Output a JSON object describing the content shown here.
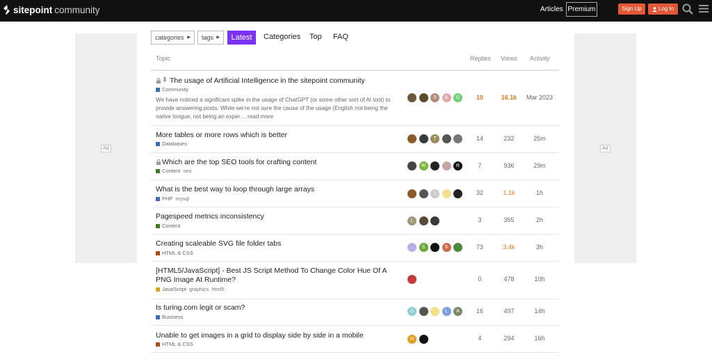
{
  "header": {
    "brand": "sitepoint",
    "brand_sub": "community",
    "nav_articles": "Articles",
    "nav_premium": "Premium",
    "signup": "Sign Up",
    "login": "Log In"
  },
  "ad_label": "Ad",
  "nav": {
    "categories_dropdown": "categories",
    "tags_dropdown": "tags",
    "latest": "Latest",
    "categories": "Categories",
    "top": "Top",
    "faq": "FAQ"
  },
  "table": {
    "col_topic": "Topic",
    "col_replies": "Replies",
    "col_views": "Views",
    "col_activity": "Activity"
  },
  "colors": {
    "accent": "#7a33f4",
    "cta": "#e45735",
    "hot": "#e0781c"
  },
  "topics": [
    {
      "title": "The usage of Artificial Intelligence in the sitepoint community",
      "locked": true,
      "pinned": true,
      "category": "Community",
      "cat_color": "#3a6bbd",
      "tags": [],
      "excerpt": "We have noticed a significant spike in the usage of ChatGPT (or some other sort of AI tool) to provide answering posts. While we’re not sure the cause of the usage (English not being the native tongue, not being an exper… read more",
      "replies": "10",
      "views": "16.1k",
      "activity": "Mar 2023"
    },
    {
      "title": "More tables or more rows which is better",
      "category": "Databases",
      "cat_color": "#3a6bbd",
      "tags": [],
      "replies": "14",
      "views": "232",
      "activity": "25m"
    },
    {
      "title": "Which are the top SEO tools for crafting content",
      "locked": true,
      "category": "Content",
      "cat_color": "#3e7a1a",
      "tags": [
        "seo"
      ],
      "replies": "7",
      "views": "936",
      "activity": "29m"
    },
    {
      "title": "What is the best way to loop through large arrays",
      "category": "PHP",
      "cat_color": "#3a6bbd",
      "tags": [
        "mysql"
      ],
      "replies": "32",
      "views": "1.1k",
      "activity": "1h"
    },
    {
      "title": "Pagespeed metrics inconsistency",
      "category": "Content",
      "cat_color": "#3e7a1a",
      "tags": [],
      "replies": "3",
      "views": "355",
      "activity": "2h"
    },
    {
      "title": "Creating scaleable SVG file folder tabs",
      "category": "HTML & CSS",
      "cat_color": "#b04a1a",
      "tags": [],
      "replies": "73",
      "views": "3.4k",
      "activity": "3h"
    },
    {
      "title": "[HTML5/JavaScript] - Best JS Script Method To Change Color Hue Of A PNG Image At Runtime?",
      "category": "JavaScript",
      "cat_color": "#d3a81c",
      "tags": [
        "graphics",
        "html5"
      ],
      "replies": "0",
      "views": "478",
      "activity": "10h"
    },
    {
      "title": "Is turing.com legit or scam?",
      "category": "Business",
      "cat_color": "#3a6bbd",
      "tags": [],
      "replies": "16",
      "views": "497",
      "activity": "14h"
    },
    {
      "title": "Unable to get images in a grid to display side by side in a mobile",
      "category": "HTML & CSS",
      "cat_color": "#b04a1a",
      "tags": [],
      "replies": "4",
      "views": "294",
      "activity": "16h"
    }
  ],
  "avatars": [
    [
      {
        "c": "#6b5a3a",
        "t": ""
      },
      {
        "c": "#5a4a2a",
        "t": ""
      },
      {
        "c": "#b08b78",
        "t": "S"
      },
      {
        "c": "#e0a8a8",
        "t": "A"
      },
      {
        "c": "#6fcf7a",
        "t": "G"
      }
    ],
    [
      {
        "c": "#8a5a2a",
        "t": ""
      },
      {
        "c": "#3a3a3a",
        "t": ""
      },
      {
        "c": "#a08a5a",
        "t": "T"
      },
      {
        "c": "#555",
        "t": ""
      },
      {
        "c": "#777",
        "t": ""
      }
    ],
    [
      {
        "c": "#444",
        "t": ""
      },
      {
        "c": "#7bb53a",
        "t": "W"
      },
      {
        "c": "#222",
        "t": ""
      },
      {
        "c": "#c7a5a5",
        "t": ""
      },
      {
        "c": "#111",
        "t": "R"
      }
    ],
    [
      {
        "c": "#8a5a2a",
        "t": ""
      },
      {
        "c": "#555",
        "t": ""
      },
      {
        "c": "#ccc",
        "t": "I"
      },
      {
        "c": "#f2e08a",
        "t": ""
      },
      {
        "c": "#222",
        "t": ""
      }
    ],
    [
      {
        "c": "#9a9a7a",
        "t": "L"
      },
      {
        "c": "#5a4a3a",
        "t": ""
      },
      {
        "c": "#3a3a3a",
        "t": ""
      }
    ],
    [
      {
        "c": "#b8b0e0",
        "t": ""
      },
      {
        "c": "#6aa83a",
        "t": "S"
      },
      {
        "c": "#111",
        "t": ""
      },
      {
        "c": "#d06a4a",
        "t": "S"
      },
      {
        "c": "#4a8a3a",
        "t": ""
      }
    ],
    [
      {
        "c": "#c83a3a",
        "t": ""
      }
    ],
    [
      {
        "c": "#8ad0d0",
        "t": "G"
      },
      {
        "c": "#555",
        "t": ""
      },
      {
        "c": "#f2e08a",
        "t": ""
      },
      {
        "c": "#7aa0e0",
        "t": "L"
      },
      {
        "c": "#7a8a6a",
        "t": "A"
      }
    ],
    [
      {
        "c": "#e0a020",
        "t": "H"
      },
      {
        "c": "#111",
        "t": ""
      }
    ]
  ]
}
